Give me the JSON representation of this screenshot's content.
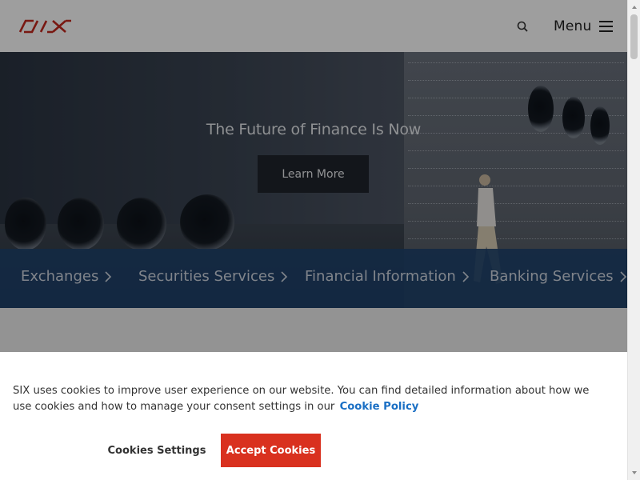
{
  "brand": {
    "logo_text": "SIX",
    "logo_color": "#d22b1f"
  },
  "header": {
    "menu_label": "Menu",
    "search_icon": "search-icon",
    "menu_icon": "hamburger-icon"
  },
  "hero": {
    "title": "The Future of Finance Is Now",
    "cta_label": "Learn More"
  },
  "categories": [
    {
      "label": "Exchanges"
    },
    {
      "label": "Securities Services"
    },
    {
      "label": "Financial Information"
    },
    {
      "label": "Banking Services"
    }
  ],
  "cookie_banner": {
    "text": "SIX uses cookies to improve user experience on our website. You can find detailed information about how we use cookies and how to manage your consent settings in our",
    "link_label": "Cookie Policy",
    "settings_label": "Cookies Settings",
    "accept_label": "Accept Cookies",
    "accent_color": "#d9311f",
    "link_color": "#1a6fc4"
  }
}
